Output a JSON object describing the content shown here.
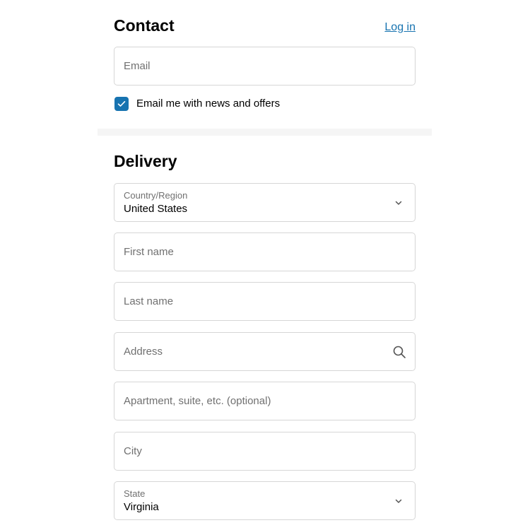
{
  "contact": {
    "title": "Contact",
    "login_link": "Log in",
    "email": {
      "placeholder": "Email",
      "value": ""
    },
    "newsletter": {
      "label": "Email me with news and offers",
      "checked": true
    }
  },
  "delivery": {
    "title": "Delivery",
    "country": {
      "label": "Country/Region",
      "value": "United States"
    },
    "first_name": {
      "placeholder": "First name",
      "value": ""
    },
    "last_name": {
      "placeholder": "Last name",
      "value": ""
    },
    "address": {
      "placeholder": "Address",
      "value": "",
      "icon": "search-icon"
    },
    "apartment": {
      "placeholder": "Apartment, suite, etc. (optional)",
      "value": ""
    },
    "city": {
      "placeholder": "City",
      "value": ""
    },
    "state": {
      "label": "State",
      "value": "Virginia"
    }
  },
  "colors": {
    "accent": "#1773b0",
    "border": "#d6d6d6",
    "placeholder": "#707070",
    "divider": "#f5f5f5"
  }
}
